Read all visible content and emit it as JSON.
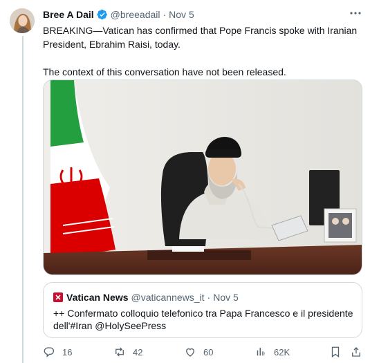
{
  "tweet": {
    "author_name": "Bree A Dail",
    "handle": "@breeadail",
    "separator": "·",
    "time": "Nov 5",
    "text_line1": "BREAKING—Vatican has confirmed that Pope Francis spoke with Iranian",
    "text_line2": "President, Ebrahim Raisi, today.",
    "text_line3": "The context of this conversation have not been released."
  },
  "quote": {
    "name": "Vatican News",
    "handle": "@vaticannews_it",
    "separator": "·",
    "time": "Nov 5",
    "text_line1": "++ Confermato colloquio telefonico tra Papa Francesco e il presidente",
    "text_line2": "dell'#Iran @HolySeePress"
  },
  "actions": {
    "replies": "16",
    "reposts": "42",
    "likes": "60",
    "views": "62K"
  },
  "colors": {
    "verified": "#1d9bf0",
    "secondary_text": "#536471",
    "border": "#cfd9de",
    "vatican_logo": "#c8102e"
  },
  "icons": [
    "verified-badge-icon",
    "more-icon",
    "reply-icon",
    "repost-icon",
    "like-icon",
    "views-icon",
    "bookmark-icon",
    "share-icon"
  ]
}
